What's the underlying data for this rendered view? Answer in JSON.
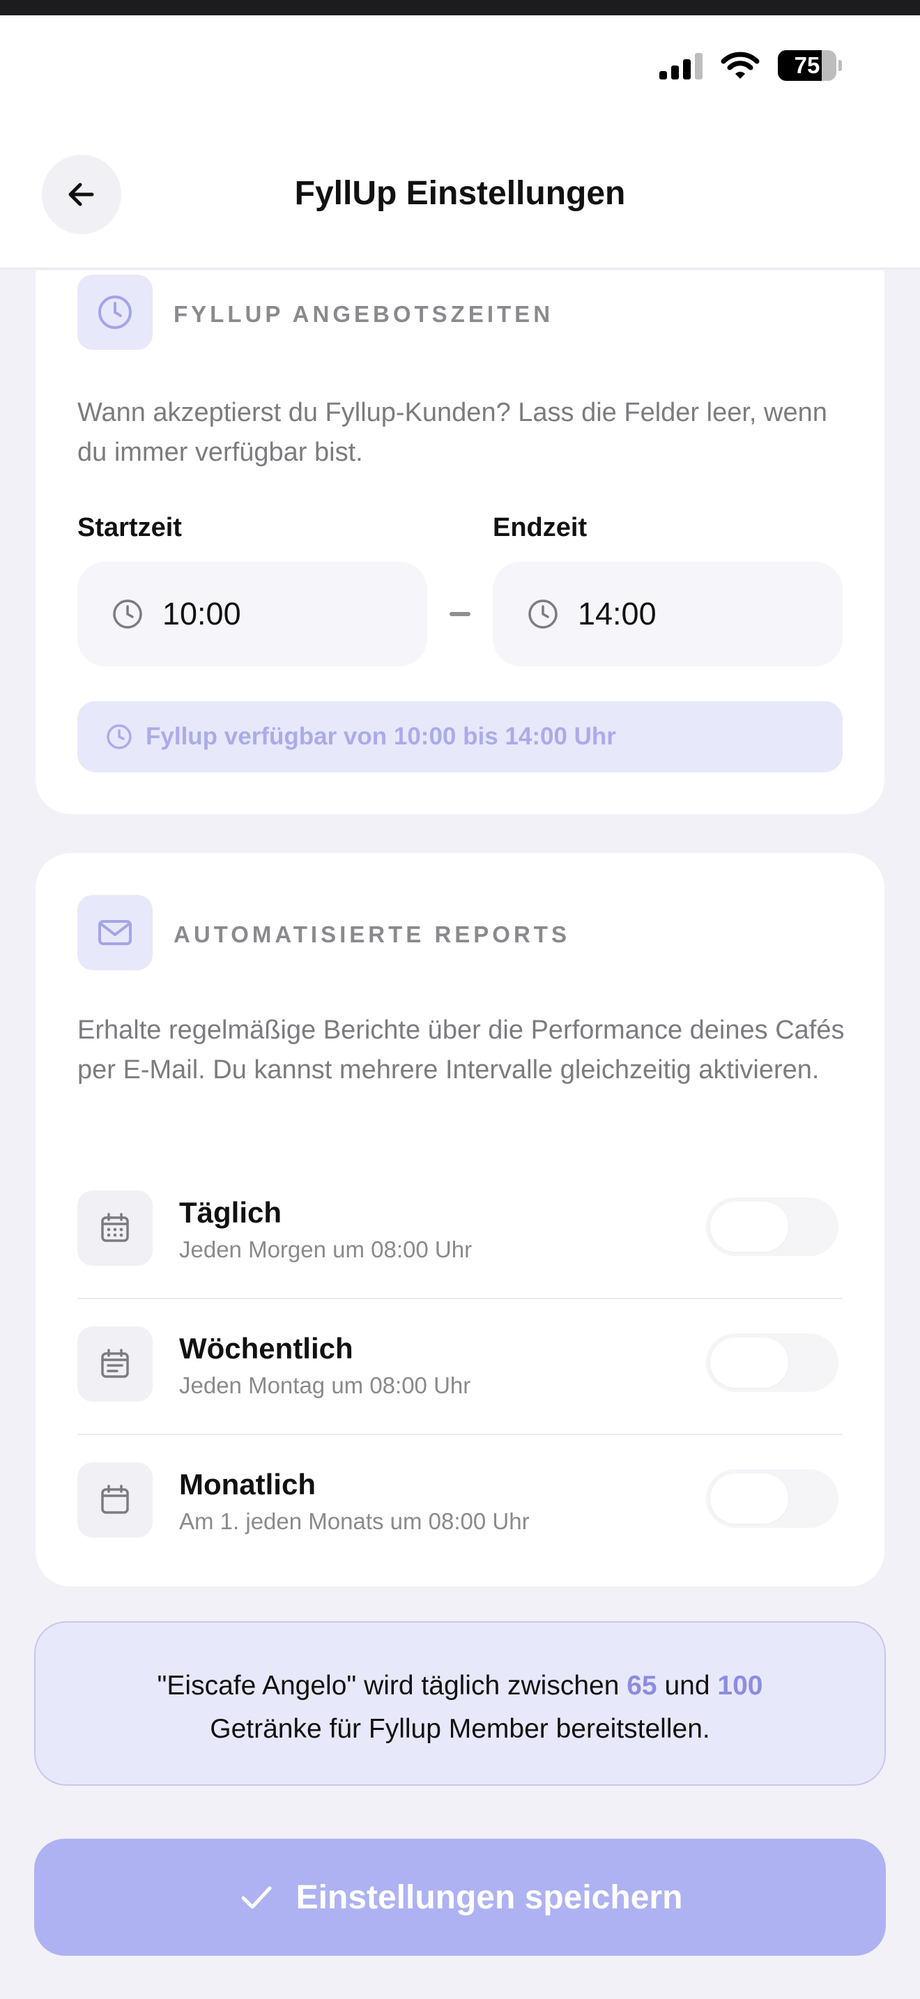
{
  "status_bar": {
    "battery": "75",
    "battery_level": 0.75
  },
  "header": {
    "title": "FyllUp Einstellungen",
    "back_icon": "arrow-left-icon"
  },
  "offer_times": {
    "icon": "clock-icon",
    "title": "FYLLUP ANGEBOTSZEITEN",
    "description": "Wann akzeptierst du Fyllup-Kunden? Lass die Felder leer, wenn du immer verfügbar bist.",
    "start_label": "Startzeit",
    "start_value": "10:00",
    "end_label": "Endzeit",
    "end_value": "14:00",
    "availability_text": "Fyllup verfügbar von 10:00 bis 14:00 Uhr"
  },
  "reports": {
    "icon": "mail-icon",
    "title": "AUTOMATISIERTE REPORTS",
    "description": "Erhalte regelmäßige Berichte über die Performance deines Cafés per E-Mail. Du kannst mehrere Intervalle gleichzeitig aktivieren.",
    "items": [
      {
        "label": "Täglich",
        "sub": "Jeden Morgen um 08:00 Uhr",
        "icon": "calendar-days-icon",
        "enabled": false
      },
      {
        "label": "Wöchentlich",
        "sub": "Jeden Montag um 08:00 Uhr",
        "icon": "calendar-week-icon",
        "enabled": false
      },
      {
        "label": "Monatlich",
        "sub": "Am 1. jeden Monats um 08:00 Uhr",
        "icon": "calendar-month-icon",
        "enabled": false
      }
    ]
  },
  "info": {
    "prefix": "\"Eiscafe Angelo\" wird täglich zwischen ",
    "min": "65",
    "middle": " und ",
    "max": "100",
    "suffix": "Getränke für Fyllup Member bereitstellen."
  },
  "save_button": {
    "label": "Einstellungen speichern",
    "icon": "checkmark-icon"
  },
  "colors": {
    "accent": "#8C8CE0",
    "accent_light": "#E8E8FB",
    "button": "#AEB2F2",
    "background": "#F1F1F7"
  }
}
